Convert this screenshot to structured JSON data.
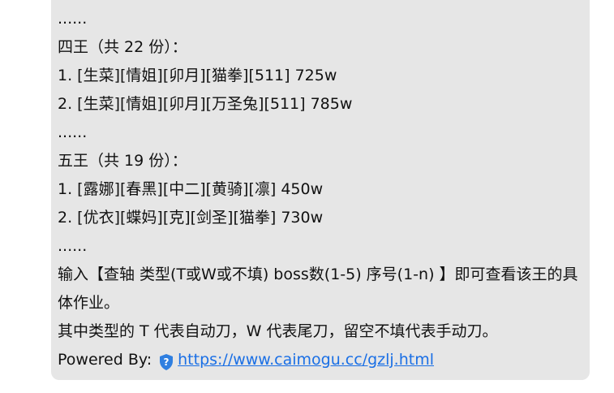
{
  "chat_message": {
    "lines": [
      "......",
      "四王（共 22 份）：",
      "1. [生菜][情姐][卯月][猫拳][511] 725w",
      "2. [生菜][情姐][卯月][万圣兔][511] 785w",
      "......",
      "五王（共 19 份）：",
      "1. [露娜][春黑][中二][黄骑][凛] 450w",
      "2. [优衣][蝶妈][克][剑圣][猫拳] 730w",
      "......",
      "输入【查轴 类型(T或W或不填) boss数(1-5) 序号(1-n) 】即可查看该王的具体作业。",
      "其中类型的 T 代表自动刀，W 代表尾刀，留空不填代表手动刀。"
    ],
    "powered_by_label": "Powered By:",
    "link_text": "https://www.caimogu.cc/gzlj.html",
    "link_icon": "shield-question-icon",
    "colors": {
      "bubble_bg": "#e6e6e6",
      "link": "#1a6fe5",
      "icon": "#2f7fe0"
    }
  }
}
